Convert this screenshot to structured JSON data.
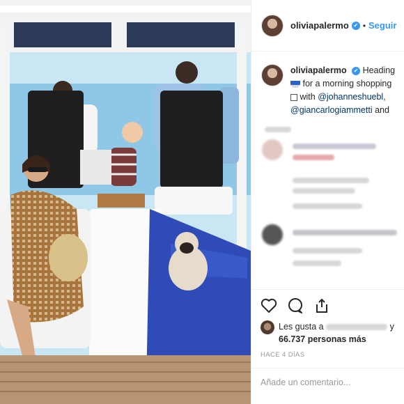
{
  "post": {
    "username": "olivia­palermo",
    "verified_icon": "✔",
    "separator": "•",
    "follow_label": "Seguir"
  },
  "caption": {
    "username": "oliviapalermo",
    "line1": "Heading",
    "line2": "for a morning shopping",
    "line3_prefix": "with ",
    "mention1": "@johanneshuebl",
    "mention2": "@giancarlogiammetti",
    "line4_suffix": " and"
  },
  "likes": {
    "prefix": "Les gusta a",
    "suffix": "y",
    "count_text": "66.737 personas más"
  },
  "timestamp": "HACE 4 DÍAS",
  "comment_placeholder": "Añade un comentario...",
  "colors": {
    "link_blue": "#3897f0",
    "mention_blue": "#003569",
    "muted": "#999999"
  },
  "icons": [
    "heart-icon",
    "comment-icon",
    "share-icon",
    "verified-icon"
  ]
}
